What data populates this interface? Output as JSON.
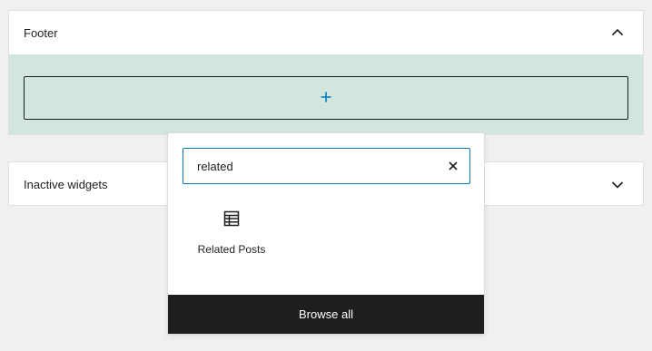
{
  "footer_panel": {
    "title": "Footer",
    "toggle_icon": "chevron-up-icon",
    "add_block_icon": "plus-icon",
    "body_color": "#d2e5de"
  },
  "inactive_panel": {
    "title": "Inactive widgets",
    "toggle_icon": "chevron-down-icon"
  },
  "inserter": {
    "search": {
      "value": "related",
      "clear_icon": "close-icon"
    },
    "results": [
      {
        "label": "Related Posts",
        "icon": "table-icon"
      }
    ],
    "browse_all_label": "Browse all"
  },
  "colors": {
    "accent": "#007cba",
    "dark": "#1e1e1e",
    "background": "#f0f0f1"
  }
}
